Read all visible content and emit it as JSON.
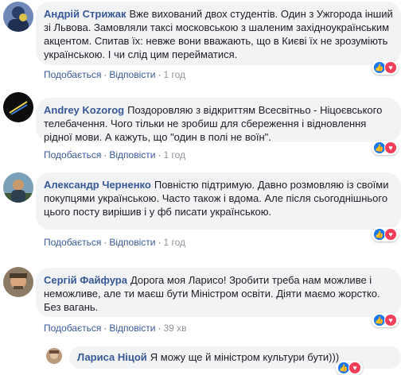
{
  "comments": [
    {
      "author": "Андрій Стрижак",
      "text": "Вже вихований двох студентів. Один з Ужгорода інший зі Львова. Замовляли таксі московською з шаленим західноукраїнським акцентом. Спитав їх: невже вони вважають, що в Києві їх не зрозуміють українською. І чи слід цим перейматися.",
      "like_label": "Подобається",
      "reply_label": "Відповісти",
      "time": "1 год"
    },
    {
      "author": "Andrey Kozorog",
      "text": "Поздоровляю з відкриттям Всесвітньо - Ніцоєвського телебачення. Чого тільки не зробиш для сбереження і відновлення рідної мови. А кажуть, що \"один в полі не воїн\".",
      "like_label": "Подобається",
      "reply_label": "Відповісти",
      "time": "1 год"
    },
    {
      "author": "Александр Черненко",
      "text": "Повністю підтримую. Давно розмовляю із своїми покупцями українською. Часто також і вдома. Але після сьогоднішнього цього посту вирішив і у фб писати українською.",
      "like_label": "Подобається",
      "reply_label": "Відповісти",
      "time": "1 год"
    },
    {
      "author": "Сергій Файфура",
      "text": "Дорога моя Ларисо! Зробити треба нам можливе і неможливе, але ти маєш бути Міністром освіти. Діяти маємо жорстко. Без вагань.",
      "like_label": "Подобається",
      "reply_label": "Відповісти",
      "time": "39 хв"
    }
  ],
  "reply": {
    "author": "Лариса Ніцой",
    "text": "Я можу ще й міністром культури бути)))"
  },
  "reaction_icons": {
    "like": "thumbs-up-icon",
    "love": "heart-icon"
  },
  "colors": {
    "link": "#385898",
    "bubble": "#f2f3f5",
    "like": "#1877f2",
    "love": "#f33e58"
  }
}
